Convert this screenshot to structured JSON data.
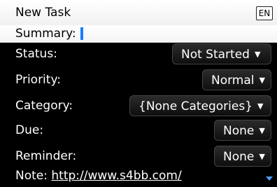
{
  "header": {
    "title": "New Task",
    "input_mode": "EN"
  },
  "form": {
    "summary_label": "Summary:",
    "summary_value": "",
    "status_label": "Status:",
    "status_value": "Not Started",
    "priority_label": "Priority:",
    "priority_value": "Normal",
    "category_label": "Category:",
    "category_value": "{None Categories}",
    "due_label": "Due:",
    "due_value": "None",
    "reminder_label": "Reminder:",
    "reminder_value": "None",
    "note_label": "Note:",
    "note_value": "http://www.s4bb.com/"
  },
  "icons": {
    "dropdown_arrow": "▼",
    "scroll_down": "scroll-down-icon"
  },
  "colors": {
    "cursor": "#1a7cff",
    "scroll_indicator": "#4aa0ff",
    "background": "#000000",
    "header_bg": "#ffffff"
  }
}
